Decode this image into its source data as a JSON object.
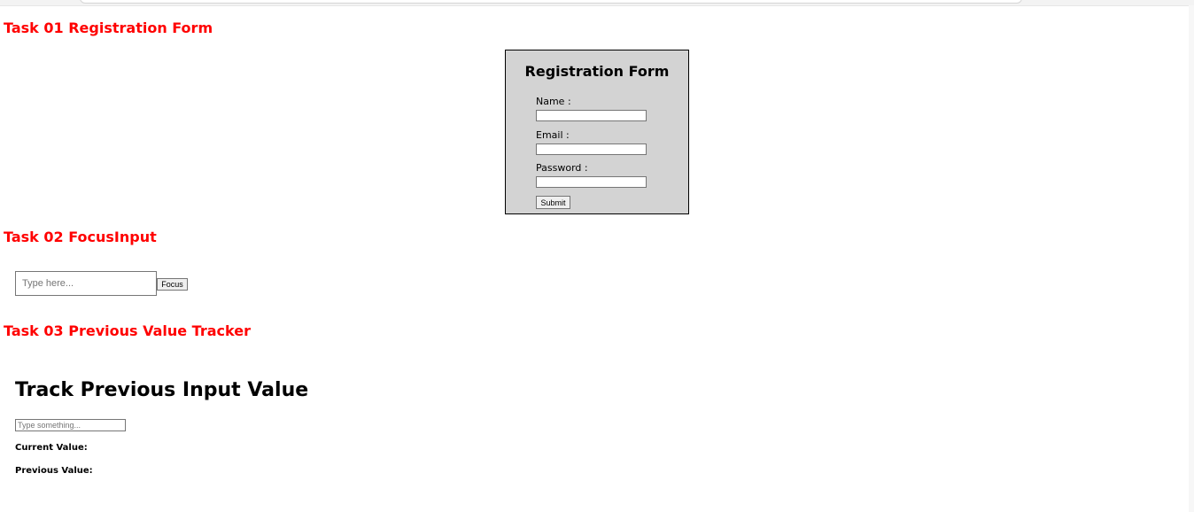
{
  "tasks": {
    "task1_title": "Task 01 Registration Form",
    "task2_title": "Task 02 FocusInput",
    "task3_title": "Task 03 Previous Value Tracker"
  },
  "registration": {
    "title": "Registration Form",
    "name_label": "Name :",
    "email_label": "Email :",
    "password_label": "Password :",
    "submit_label": "Submit",
    "name_value": "",
    "email_value": "",
    "password_value": ""
  },
  "focus": {
    "placeholder": "Type here...",
    "value": "",
    "button_label": "Focus"
  },
  "tracker": {
    "heading": "Track Previous Input Value",
    "placeholder": "Type something...",
    "value": "",
    "current_label": "Current Value:",
    "previous_label": "Previous Value:"
  },
  "colors": {
    "task_title": "#ff0000",
    "form_background": "#d3d3d3"
  }
}
